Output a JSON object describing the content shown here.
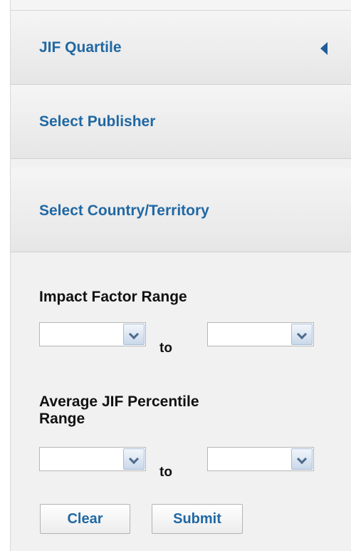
{
  "accordion": {
    "items": [
      {
        "label": "JIF Quartile",
        "expanded_indicator": "collapse-arrow-icon"
      },
      {
        "label": "Select Publisher"
      },
      {
        "label": "Select Country/Territory"
      }
    ]
  },
  "impact_factor": {
    "title": "Impact Factor Range",
    "from_value": "",
    "to_label": "to",
    "to_value": ""
  },
  "jif_percentile": {
    "title_line1": "Average JIF Percentile",
    "title_line2": "Range",
    "from_value": "",
    "to_label": "to",
    "to_value": ""
  },
  "actions": {
    "clear_label": "Clear",
    "submit_label": "Submit"
  },
  "colors": {
    "link_blue": "#2168a3",
    "panel_bg": "#f1f1f1",
    "title_text": "#111111"
  }
}
